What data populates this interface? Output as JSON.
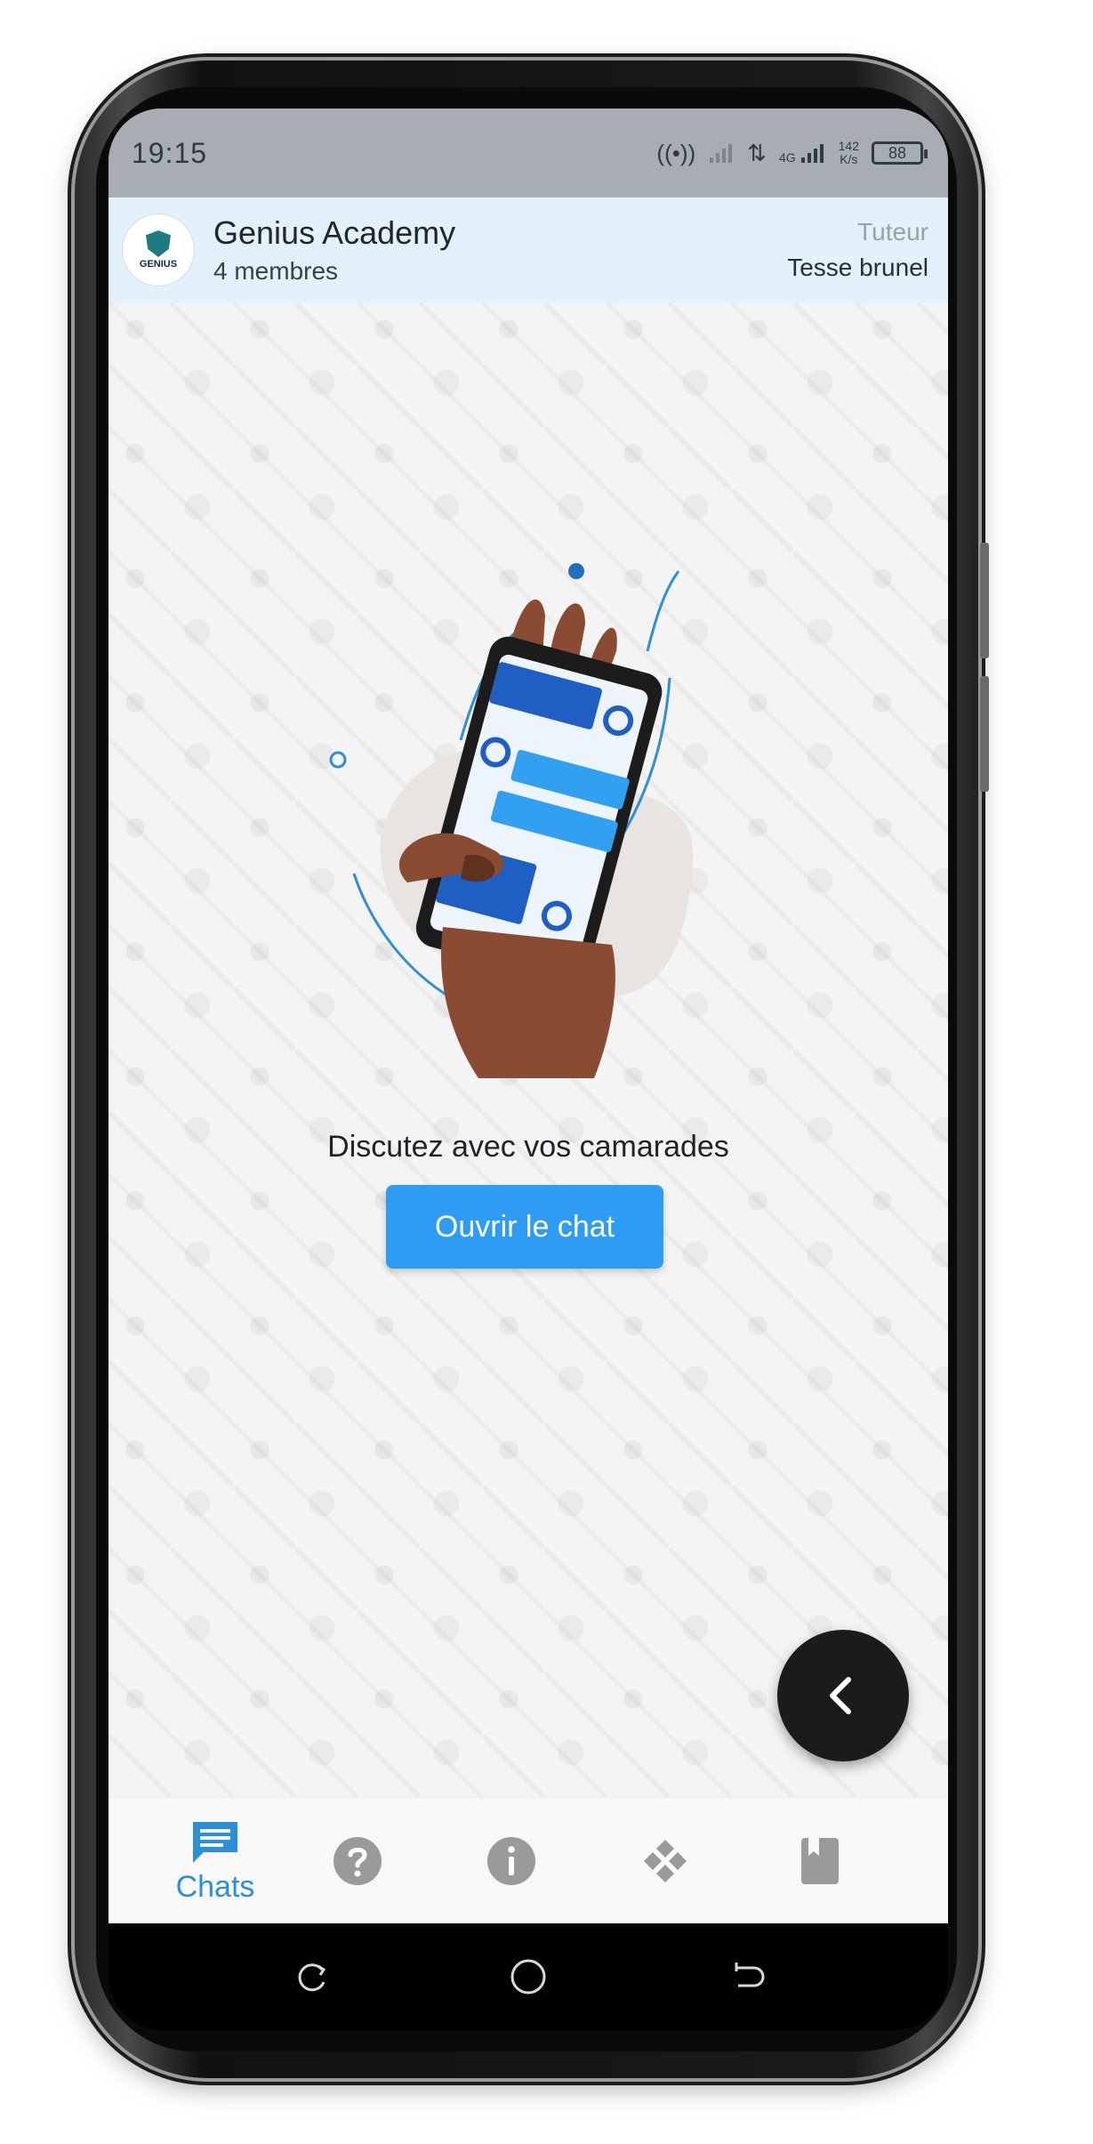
{
  "status_bar": {
    "time": "19:15",
    "network_label": "4G",
    "speed_value": "142",
    "speed_unit": "K/s",
    "battery": "88"
  },
  "header": {
    "group_name": "Genius Academy",
    "members": "4 membres",
    "role_label": "Tuteur",
    "tutor_name": "Tesse brunel",
    "logo_text": "GENIUS"
  },
  "main": {
    "prompt": "Discutez avec vos camarades",
    "open_chat_label": "Ouvrir le chat"
  },
  "bottom_nav": {
    "items": [
      {
        "icon": "chat-icon",
        "label": "Chats",
        "active": true
      },
      {
        "icon": "help-icon",
        "label": "",
        "active": false
      },
      {
        "icon": "info-icon",
        "label": "",
        "active": false
      },
      {
        "icon": "games-icon",
        "label": "",
        "active": false
      },
      {
        "icon": "book-icon",
        "label": "",
        "active": false
      }
    ]
  },
  "colors": {
    "accent": "#2d9cf2",
    "nav_active": "#2d8fd6",
    "nav_inactive": "#9a9a9a",
    "header_bg": "#e3f1fb",
    "status_bar_bg": "#a8adb3"
  }
}
